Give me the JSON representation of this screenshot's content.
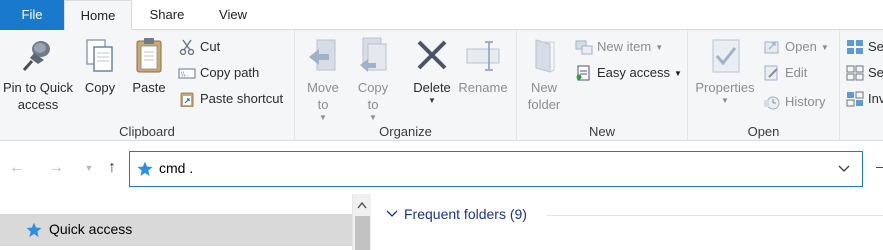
{
  "tabs": {
    "file": "File",
    "home": "Home",
    "share": "Share",
    "view": "View"
  },
  "clipboard": {
    "group_label": "Clipboard",
    "pin_line1": "Pin to Quick",
    "pin_line2": "access",
    "copy": "Copy",
    "paste": "Paste",
    "cut": "Cut",
    "copy_path": "Copy path",
    "paste_shortcut": "Paste shortcut"
  },
  "organize": {
    "group_label": "Organize",
    "move_line1": "Move",
    "move_line2": "to",
    "copy_line1": "Copy",
    "copy_line2": "to",
    "delete": "Delete",
    "rename": "Rename"
  },
  "new": {
    "group_label": "New",
    "new_folder_line1": "New",
    "new_folder_line2": "folder",
    "new_item": "New item",
    "easy_access": "Easy access"
  },
  "open": {
    "group_label": "Open",
    "properties": "Properties",
    "open": "Open",
    "edit": "Edit",
    "history": "History"
  },
  "select": {
    "item1": "Se",
    "item2": "Se",
    "item3": "Inv"
  },
  "address": {
    "value": "cmd ."
  },
  "navpane": {
    "quick_access": "Quick access"
  },
  "content": {
    "section_title": "Frequent folders (9)"
  },
  "colors": {
    "accent": "#1979ca",
    "ribbon_bg": "#f5f6f7",
    "selected_row": "#d9d9d9",
    "section_text": "#1e3287"
  }
}
